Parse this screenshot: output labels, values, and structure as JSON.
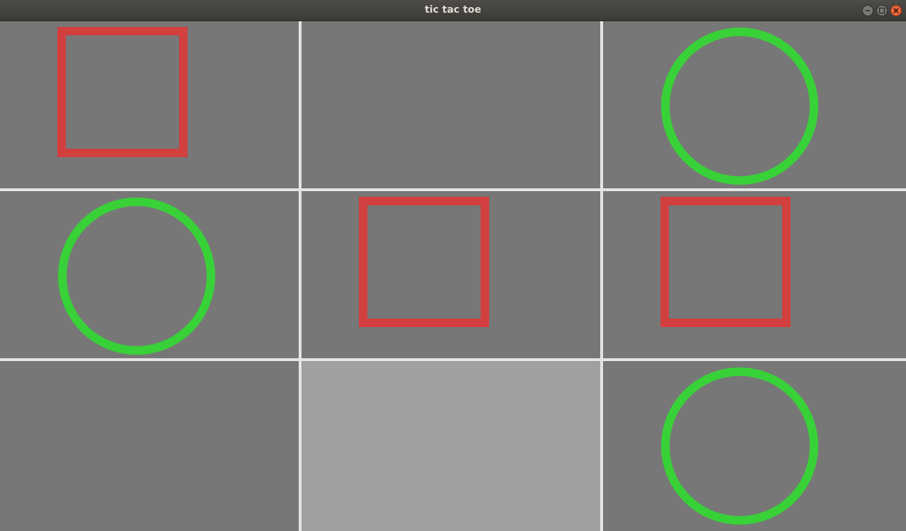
{
  "window": {
    "title": "tic tac toe"
  },
  "window_controls": {
    "minimize_icon": "minimize-icon",
    "maximize_icon": "maximize-icon",
    "close_icon": "close-icon"
  },
  "colors": {
    "cell_background": "#777777",
    "cell_hover_background": "#a0a0a0",
    "grid_lines": "#e4e4e4",
    "square_mark": "#d13f3f",
    "circle_mark": "#38d138",
    "close_button": "#e9653b"
  },
  "board": {
    "rows": [
      [
        {
          "mark": "square"
        },
        {
          "mark": ""
        },
        {
          "mark": "circle"
        }
      ],
      [
        {
          "mark": "circle"
        },
        {
          "mark": "square"
        },
        {
          "mark": "square"
        }
      ],
      [
        {
          "mark": ""
        },
        {
          "mark": "",
          "hovered": true
        },
        {
          "mark": "circle"
        }
      ]
    ]
  }
}
